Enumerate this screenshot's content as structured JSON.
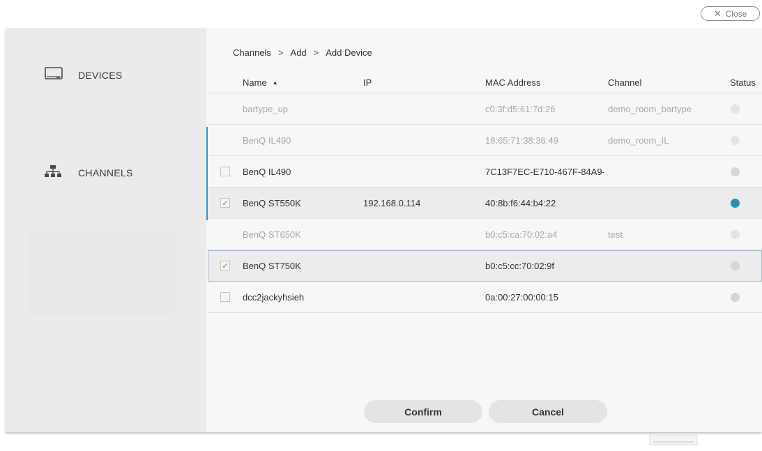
{
  "close_label": "Close",
  "sidebar": {
    "devices_label": "DEVICES",
    "channels_label": "CHANNELS"
  },
  "breadcrumb": [
    "Channels",
    "Add",
    "Add Device"
  ],
  "breadcrumb_sep": ">",
  "columns": {
    "name": "Name",
    "ip": "IP",
    "mac": "MAC Address",
    "channel": "Channel",
    "status": "Status"
  },
  "rows": [
    {
      "name": "bartype_up",
      "ip": "",
      "mac": "c0:3f:d5:61:7d:26",
      "channel": "demo_room_bartype",
      "state": "disabled",
      "checked": false,
      "status": "offline"
    },
    {
      "name": "BenQ IL490",
      "ip": "",
      "mac": "18:65:71:38:36:49",
      "channel": "demo_room_IL",
      "state": "disabled",
      "checked": false,
      "status": "offline"
    },
    {
      "name": "BenQ IL490",
      "ip": "",
      "mac": "7C13F7EC-E710-467F-84A9-...",
      "channel": "",
      "state": "enabled",
      "checked": false,
      "status": "offline"
    },
    {
      "name": "BenQ ST550K",
      "ip": "192.168.0.114",
      "mac": "40:8b:f6:44:b4:22",
      "channel": "",
      "state": "enabled",
      "checked": true,
      "status": "online"
    },
    {
      "name": "BenQ ST650K",
      "ip": "",
      "mac": "b0:c5:ca:70:02:a4",
      "channel": "test",
      "state": "disabled",
      "checked": false,
      "status": "offline"
    },
    {
      "name": "BenQ ST750K",
      "ip": "",
      "mac": "b0:c5:cc:70:02:9f",
      "channel": "",
      "state": "focused",
      "checked": true,
      "status": "offline"
    },
    {
      "name": "dcc2jackyhsieh",
      "ip": "",
      "mac": "0a:00:27:00:00:15",
      "channel": "",
      "state": "enabled",
      "checked": false,
      "status": "offline"
    }
  ],
  "buttons": {
    "confirm": "Confirm",
    "cancel": "Cancel"
  },
  "colors": {
    "accent": "#3b8fc8",
    "status_online": "#2a8fb0",
    "status_offline": "#d6d6d6"
  },
  "icons": {
    "close": "close-icon",
    "devices": "monitor-icon",
    "channels": "network-icon",
    "sort": "sort-ascending-icon",
    "check": "checkmark-icon"
  }
}
